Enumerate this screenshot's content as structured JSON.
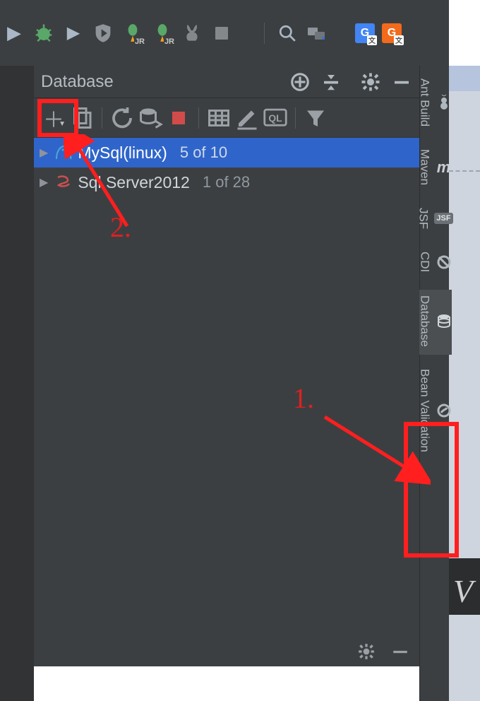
{
  "ribbon": {
    "run": "▶",
    "debug": "bug",
    "play": "▶",
    "shield": "shield",
    "jr1": "JR",
    "jr2": "JR",
    "rabbit": "✦",
    "stop": "■",
    "search": "search",
    "folders": "files",
    "gx_blue": "G",
    "gx_orange": "G",
    "gx_badge": "文"
  },
  "panel": {
    "title": "Database",
    "header_icons": {
      "target": "target",
      "collapse": "collapse",
      "gear": "gear",
      "minimize": "—"
    },
    "toolbar": {
      "add": "＋",
      "duplicate": "⧉",
      "refresh": "↻",
      "sync": "⇄",
      "stop": "■",
      "table": "▦",
      "edit": "✎",
      "console": "QL",
      "filter": "▼"
    },
    "rows": [
      {
        "name": "MySql(linux)",
        "count": "5 of 10",
        "db": "mysql",
        "selected": true
      },
      {
        "name": "Sql Server2012",
        "count": "1 of 28",
        "db": "mssql",
        "selected": false
      }
    ],
    "footer": {
      "gear": "gear",
      "minimize": "—"
    }
  },
  "rail": {
    "items": [
      {
        "id": "ant",
        "label": "Ant Build",
        "icon": "ant"
      },
      {
        "id": "maven",
        "label": "Maven",
        "icon": "m"
      },
      {
        "id": "jsf",
        "label": "JSF",
        "icon": "JSF"
      },
      {
        "id": "cdi",
        "label": "CDI",
        "icon": "cdi"
      },
      {
        "id": "db",
        "label": "Database",
        "icon": "db",
        "active": true
      },
      {
        "id": "bean",
        "label": "Bean Validation",
        "icon": "bean"
      }
    ]
  },
  "annotations": {
    "one": "1.",
    "two": "2."
  }
}
